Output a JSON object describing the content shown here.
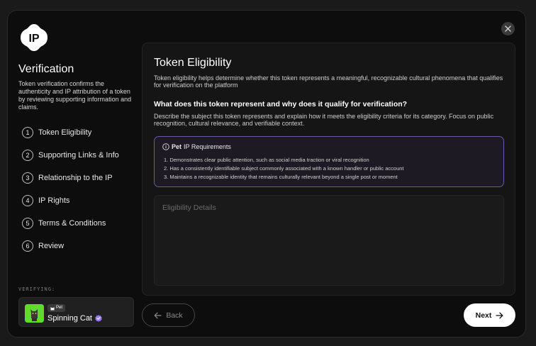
{
  "logo": {
    "text": "IP"
  },
  "sidebar": {
    "title": "Verification",
    "description": "Token verification confirms the authenticity and IP attribution of a token by reviewing supporting information and claims.",
    "steps": [
      {
        "num": "1",
        "label": "Token Eligibility"
      },
      {
        "num": "2",
        "label": "Supporting Links & Info"
      },
      {
        "num": "3",
        "label": "Relationship to the IP"
      },
      {
        "num": "4",
        "label": "IP Rights"
      },
      {
        "num": "5",
        "label": "Terms & Conditions"
      },
      {
        "num": "6",
        "label": "Review"
      }
    ],
    "verifying_label": "VERIFYING:",
    "card": {
      "badge": "Pet",
      "name": "Spinning Cat"
    }
  },
  "panel": {
    "title": "Token Eligibility",
    "description": "Token eligibility helps determine whether this token represents a meaningful, recognizable cultural phenomena that qualifies for verification on the platform",
    "question": "What does this token represent and why does it qualify for verification?",
    "question_desc": "Describe the subject this token represents and explain how it meets the eligibility criteria for its category. Focus on public recognition, cultural relevance, and verifiable context.",
    "requirements": {
      "category": "Pet",
      "title_rest": "IP Requirements",
      "items": [
        "1. Demonstrates clear public attention, such as social media traction or viral recognition",
        "2. Has a consistently identifiable subject commonly associated with a known handler or public account",
        "3. Maintains a recognizable identity that remains culturally relevant beyond a single post or moment"
      ]
    },
    "textarea_placeholder": "Eligibility Details"
  },
  "footer": {
    "back_label": "Back",
    "next_label": "Next"
  }
}
